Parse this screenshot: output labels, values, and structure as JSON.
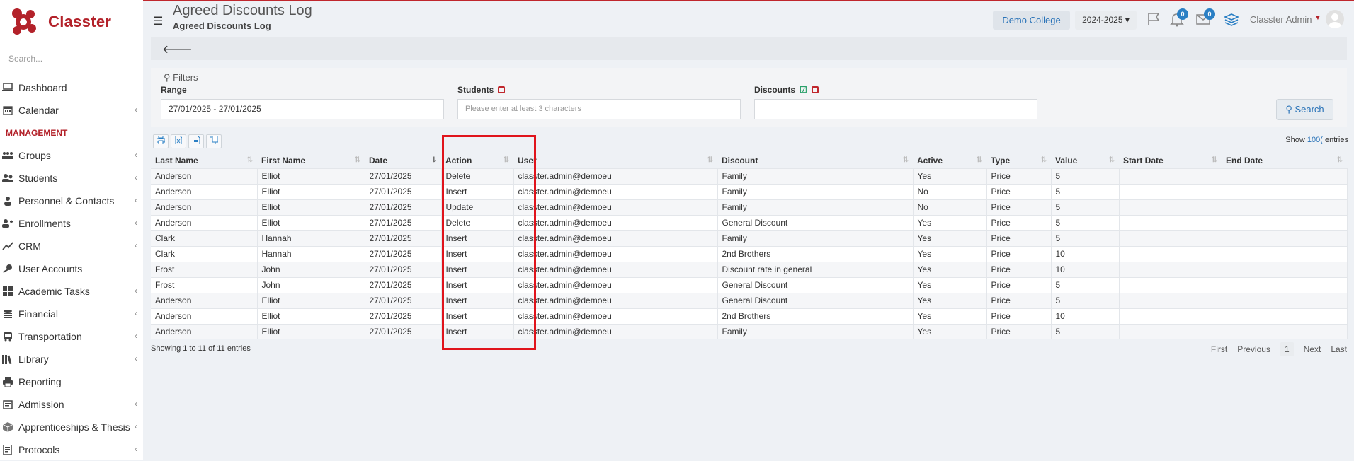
{
  "brand": {
    "name": "Classter"
  },
  "sidebar": {
    "search_placeholder": "Search...",
    "section_header": "MANAGEMENT",
    "items_top": [
      {
        "label": "Dashboard",
        "icon": "laptop-icon",
        "chevron": false
      },
      {
        "label": "Calendar",
        "icon": "calendar-icon",
        "chevron": true
      }
    ],
    "items": [
      {
        "label": "Groups",
        "icon": "groups-icon",
        "chevron": true
      },
      {
        "label": "Students",
        "icon": "students-icon",
        "chevron": true
      },
      {
        "label": "Personnel & Contacts",
        "icon": "person-icon",
        "chevron": true
      },
      {
        "label": "Enrollments",
        "icon": "enrollments-icon",
        "chevron": true
      },
      {
        "label": "CRM",
        "icon": "crm-icon",
        "chevron": true
      },
      {
        "label": "User Accounts",
        "icon": "user-key-icon",
        "chevron": false
      },
      {
        "label": "Academic Tasks",
        "icon": "grid-icon",
        "chevron": true
      },
      {
        "label": "Financial",
        "icon": "coins-icon",
        "chevron": true
      },
      {
        "label": "Transportation",
        "icon": "bus-icon",
        "chevron": true
      },
      {
        "label": "Library",
        "icon": "books-icon",
        "chevron": true
      },
      {
        "label": "Reporting",
        "icon": "printer-icon",
        "chevron": false
      },
      {
        "label": "Admission",
        "icon": "admission-icon",
        "chevron": true
      },
      {
        "label": "Apprenticeships & Thesis",
        "icon": "cube-icon",
        "chevron": true
      },
      {
        "label": "Protocols",
        "icon": "protocols-icon",
        "chevron": true
      }
    ]
  },
  "header": {
    "title": "Agreed Discounts Log",
    "subtitle": "Agreed Discounts Log",
    "college": "Demo College",
    "year": "2024-2025",
    "notifications_count": "0",
    "messages_count": "0",
    "user_name": "Classter Admin"
  },
  "filters": {
    "title": "Filters",
    "range_label": "Range",
    "range_value": "27/01/2025 - 27/01/2025",
    "students_label": "Students",
    "students_placeholder": "Please enter at least 3 characters",
    "discounts_label": "Discounts",
    "discounts_value": "",
    "search_label": "Search"
  },
  "table": {
    "show_label": "Show",
    "page_size": "100(",
    "entries_label": "entries",
    "columns": [
      "Last Name",
      "First Name",
      "Date",
      "Action",
      "User",
      "Discount",
      "Active",
      "Type",
      "Value",
      "Start Date",
      "End Date"
    ],
    "rows": [
      [
        "Anderson",
        "Elliot",
        "27/01/2025",
        "Delete",
        "classter.admin@demoeu",
        "Family",
        "Yes",
        "Price",
        "5",
        "",
        ""
      ],
      [
        "Anderson",
        "Elliot",
        "27/01/2025",
        "Insert",
        "classter.admin@demoeu",
        "Family",
        "No",
        "Price",
        "5",
        "",
        ""
      ],
      [
        "Anderson",
        "Elliot",
        "27/01/2025",
        "Update",
        "classter.admin@demoeu",
        "Family",
        "No",
        "Price",
        "5",
        "",
        ""
      ],
      [
        "Anderson",
        "Elliot",
        "27/01/2025",
        "Delete",
        "classter.admin@demoeu",
        "General Discount",
        "Yes",
        "Price",
        "5",
        "",
        ""
      ],
      [
        "Clark",
        "Hannah",
        "27/01/2025",
        "Insert",
        "classter.admin@demoeu",
        "Family",
        "Yes",
        "Price",
        "5",
        "",
        ""
      ],
      [
        "Clark",
        "Hannah",
        "27/01/2025",
        "Insert",
        "classter.admin@demoeu",
        "2nd Brothers",
        "Yes",
        "Price",
        "10",
        "",
        ""
      ],
      [
        "Frost",
        "John",
        "27/01/2025",
        "Insert",
        "classter.admin@demoeu",
        "Discount rate in general",
        "Yes",
        "Price",
        "10",
        "",
        ""
      ],
      [
        "Frost",
        "John",
        "27/01/2025",
        "Insert",
        "classter.admin@demoeu",
        "General Discount",
        "Yes",
        "Price",
        "5",
        "",
        ""
      ],
      [
        "Anderson",
        "Elliot",
        "27/01/2025",
        "Insert",
        "classter.admin@demoeu",
        "General Discount",
        "Yes",
        "Price",
        "5",
        "",
        ""
      ],
      [
        "Anderson",
        "Elliot",
        "27/01/2025",
        "Insert",
        "classter.admin@demoeu",
        "2nd Brothers",
        "Yes",
        "Price",
        "10",
        "",
        ""
      ],
      [
        "Anderson",
        "Elliot",
        "27/01/2025",
        "Insert",
        "classter.admin@demoeu",
        "Family",
        "Yes",
        "Price",
        "5",
        "",
        ""
      ]
    ],
    "showing_text": "Showing 1 to 11 of 11 entries",
    "pager": {
      "first": "First",
      "previous": "Previous",
      "current": "1",
      "next": "Next",
      "last": "Last"
    }
  },
  "colors": {
    "accent": "#b3222a",
    "link": "#2a73b8",
    "highlight": "#e0141c"
  }
}
